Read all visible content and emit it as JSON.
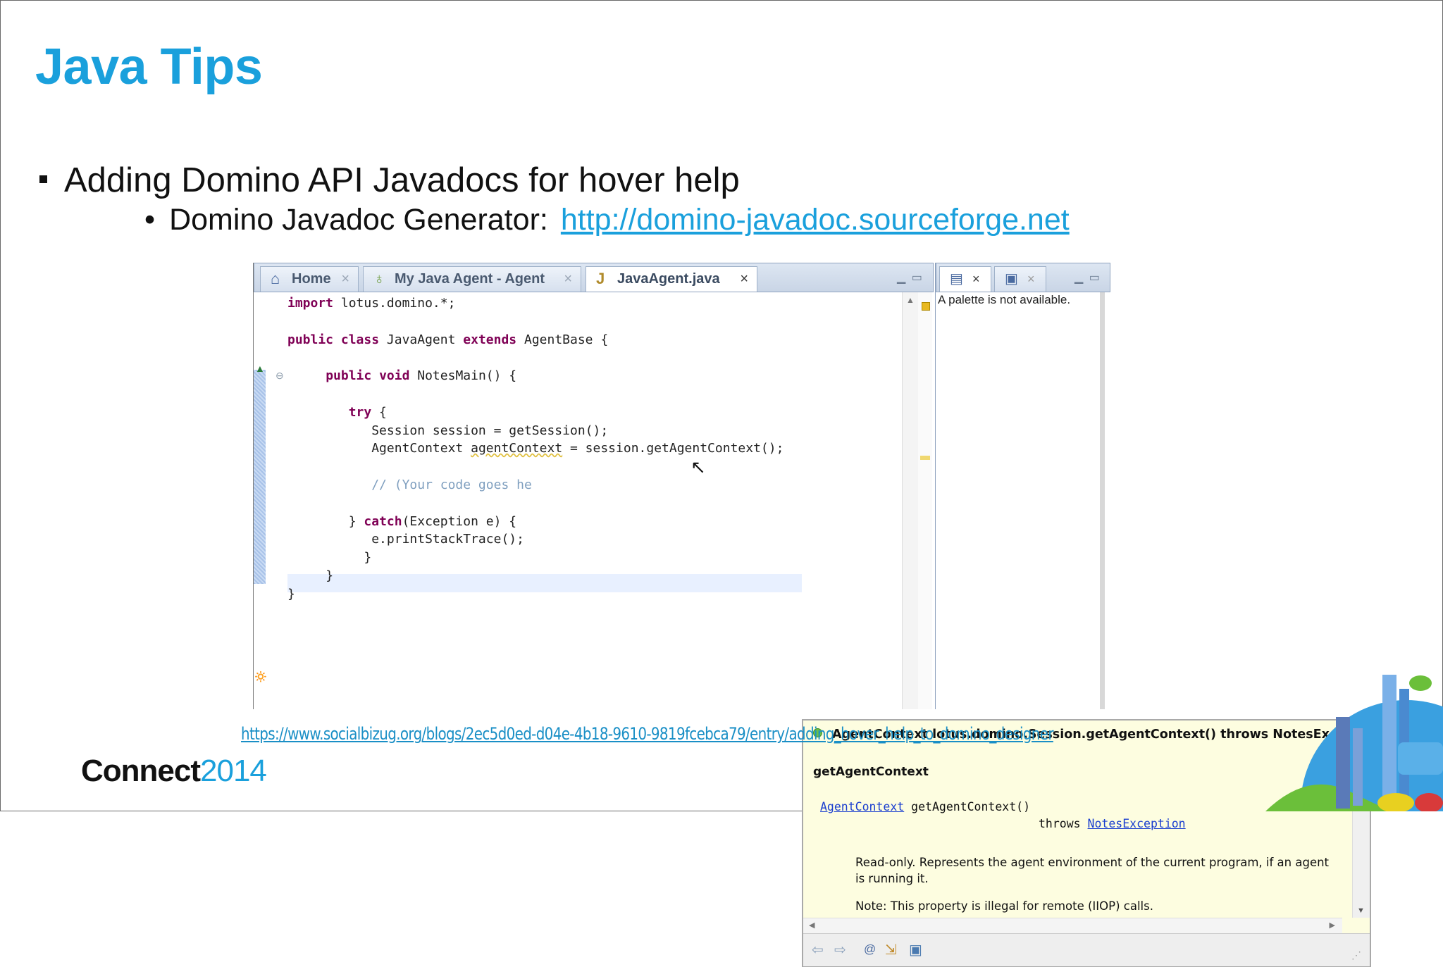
{
  "slide": {
    "title": "Java Tips",
    "bullet1": "Adding Domino API Javadocs for hover help",
    "bullet2_label": "Domino Javadoc Generator:",
    "bullet2_link": "http://domino-javadoc.sourceforge.net",
    "footer_link": "https://www.socialbizug.org/blogs/2ec5d0ed-d04e-4b18-9610-9819fcebca79/entry/adding_hover_help_to_domino_designer",
    "logo_word": "Connect",
    "logo_year": "2014"
  },
  "ide": {
    "tabs": [
      {
        "label": "Home",
        "icon": "home-icon"
      },
      {
        "label": "My Java Agent - Agent",
        "icon": "agent-icon"
      },
      {
        "label": "JavaAgent.java",
        "icon": "java-file-icon"
      }
    ],
    "right_panel_text": "A palette is not available.",
    "code": {
      "l1_kw": "import",
      "l1_rest": " lotus.domino.*;",
      "l3_kw1": "public",
      "l3_kw2": "class",
      "l3_mid": " JavaAgent ",
      "l3_kw3": "extends",
      "l3_rest": " AgentBase {",
      "l5_kw1": "public",
      "l5_kw2": "void",
      "l5_rest": " NotesMain() {",
      "l7_kw": "try",
      "l7_rest": " {",
      "l8": "Session session = getSession();",
      "l9_a": "AgentContext ",
      "l9_var": "agentContext",
      "l9_b": " = session.getAgentContext();",
      "l11": "// (Your code goes he",
      "l13_kw": "catch",
      "l13_a": "} ",
      "l13_b": "(Exception e) {",
      "l14": "e.printStackTrace();",
      "l15": "}",
      "l16": "}",
      "l17": "}"
    },
    "popup": {
      "header": "AgentContext lotus.domino.Session.getAgentContext() throws NotesException",
      "name": "getAgentContext",
      "sig_type": "AgentContext",
      "sig_method": " getAgentContext()",
      "throws_kw": "throws ",
      "throws_type": "NotesException",
      "description": "Read-only. Represents the agent environment of the current program, if an agent is running it.",
      "note": "Note: This property is illegal for remote (IIOP) calls."
    }
  },
  "colors": {
    "accent": "#1aa0dc",
    "keyword": "#7f0055",
    "link": "#1a3ecf",
    "popup_bg": "#fdfde0"
  }
}
